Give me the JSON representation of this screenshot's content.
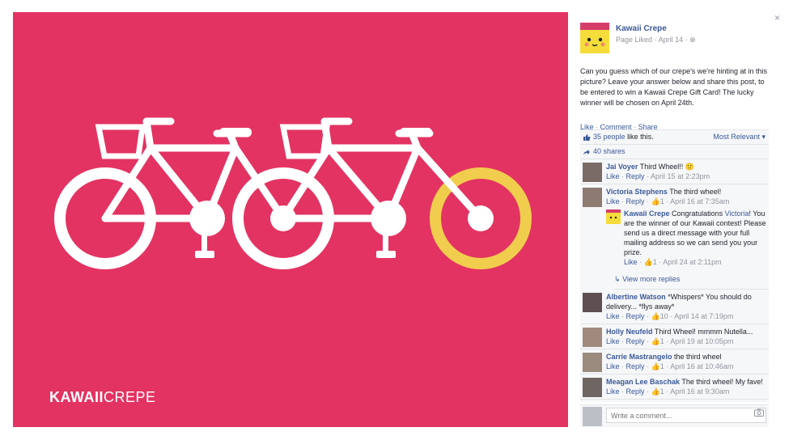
{
  "photo": {
    "brand_bold": "KAWAII",
    "brand_light": "CREPE",
    "background_color": "#e33362",
    "highlight_color": "#f1cd4e"
  },
  "close_label": "×",
  "page": {
    "name": "Kawaii Crepe",
    "liked": "Page Liked",
    "date": "April 14",
    "post": "Can you guess which of our crepe's we're hinting at in this picture? Leave your answer below and share this post, to be entered to win a Kawaii Crepe Gift Card! The lucky winner will be chosen on April 24th."
  },
  "actions": {
    "like": "Like",
    "comment": "Comment",
    "share": "Share"
  },
  "ufi": {
    "likes_count": "35 people",
    "likes_suffix": "like this.",
    "sort": "Most Relevant",
    "shares": "40 shares",
    "view_more": "View more replies"
  },
  "comments": [
    {
      "name": "Jai Voyer",
      "text": "Third Wheel!! 🙂",
      "like": "Like",
      "reply": "Reply",
      "likes": "",
      "date": "April 15 at 2:23pm"
    },
    {
      "name": "Victoria Stephens",
      "text": "The third wheel!",
      "like": "Like",
      "reply": "Reply",
      "likes": "1",
      "date": "April 16 at 7:35am"
    },
    {
      "name": "Albertine Watson",
      "text": "*Whispers* You should do delivery... *flys away*",
      "like": "Like",
      "reply": "Reply",
      "likes": "10",
      "date": "April 14 at 7:19pm"
    },
    {
      "name": "Holly Neufeld",
      "text": "Third Wheel! mmmm Nutella...",
      "like": "Like",
      "reply": "Reply",
      "likes": "1",
      "date": "April 19 at 10:05pm"
    },
    {
      "name": "Carrie Mastrangelo",
      "text": "the third wheel",
      "like": "Like",
      "reply": "Reply",
      "likes": "1",
      "date": "April 16 at 10:46am"
    },
    {
      "name": "Meagan Lee Baschak",
      "text": "The third wheel! My fave!",
      "like": "Like",
      "reply": "Reply",
      "likes": "1",
      "date": "April 16 at 9:30am"
    }
  ],
  "reply": {
    "name": "Kawaii Crepe",
    "text_before": "Congratulations",
    "mention": "Victoria",
    "text_after": "! You are the winner of our Kawaii contest! Please send us a direct message with your full mailing address so we can send you your prize.",
    "like": "Like",
    "likes": "1",
    "date": "April 24 at 2:11pm"
  },
  "composer": {
    "placeholder": "Write a comment..."
  }
}
